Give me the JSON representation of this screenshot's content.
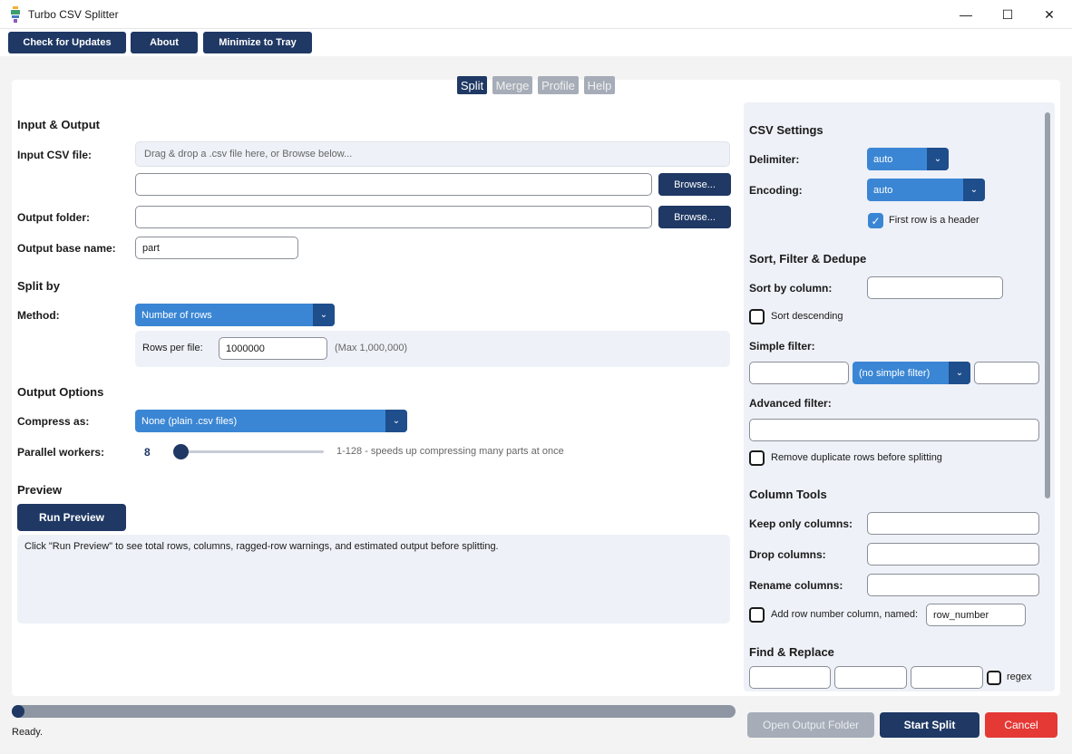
{
  "window": {
    "title": "Turbo CSV Splitter",
    "min_glyph": "—",
    "max_glyph": "☐",
    "close_glyph": "✕"
  },
  "toolbar": {
    "check_updates": "Check for Updates",
    "about": "About",
    "minimize_tray": "Minimize to Tray"
  },
  "tabs": [
    {
      "label": "Split",
      "active": true
    },
    {
      "label": "Merge",
      "active": false
    },
    {
      "label": "Profile",
      "active": false
    },
    {
      "label": "Help",
      "active": false
    }
  ],
  "input_output": {
    "title": "Input & Output",
    "input_label": "Input CSV file:",
    "dropzone_text": "Drag & drop a .csv file here, or Browse below...",
    "input_value": "",
    "browse_label": "Browse...",
    "output_folder_label": "Output folder:",
    "output_folder_value": "",
    "base_name_label": "Output base name:",
    "base_name_value": "part"
  },
  "split_by": {
    "title": "Split by",
    "method_label": "Method:",
    "method_value": "Number of rows",
    "rows_per_file_label": "Rows per file:",
    "rows_per_file_value": "1000000",
    "max_hint": "(Max 1,000,000)"
  },
  "output_options": {
    "title": "Output Options",
    "compress_label": "Compress as:",
    "compress_value": "None (plain .csv files)",
    "workers_label": "Parallel workers:",
    "workers_value": "8",
    "workers_min": 1,
    "workers_max": 128,
    "workers_hint": "1-128 - speeds up compressing many parts at once"
  },
  "preview": {
    "title": "Preview",
    "run_label": "Run Preview",
    "text": "Click \"Run Preview\" to see total rows, columns, ragged-row warnings, and estimated output before splitting."
  },
  "csv_settings": {
    "title": "CSV Settings",
    "delimiter_label": "Delimiter:",
    "delimiter_value": "auto",
    "encoding_label": "Encoding:",
    "encoding_value": "auto",
    "header_label": "First row is a header",
    "header_checked": true
  },
  "sort_filter": {
    "title": "Sort, Filter & Dedupe",
    "sort_label": "Sort by column:",
    "sort_value": "",
    "descending_label": "Sort descending",
    "simple_filter_label": "Simple filter:",
    "simple_filter_op": "(no simple filter)",
    "advanced_filter_label": "Advanced filter:",
    "dedupe_label": "Remove duplicate rows before splitting"
  },
  "column_tools": {
    "title": "Column Tools",
    "keep_label": "Keep only columns:",
    "drop_label": "Drop columns:",
    "rename_label": "Rename columns:",
    "rownum_label": "Add row number column, named:",
    "rownum_value": "row_number"
  },
  "find_replace": {
    "title": "Find & Replace",
    "regex_label": "regex"
  },
  "footer": {
    "progress": 0,
    "status": "Ready.",
    "open_folder": "Open Output Folder",
    "start": "Start Split",
    "cancel": "Cancel"
  }
}
